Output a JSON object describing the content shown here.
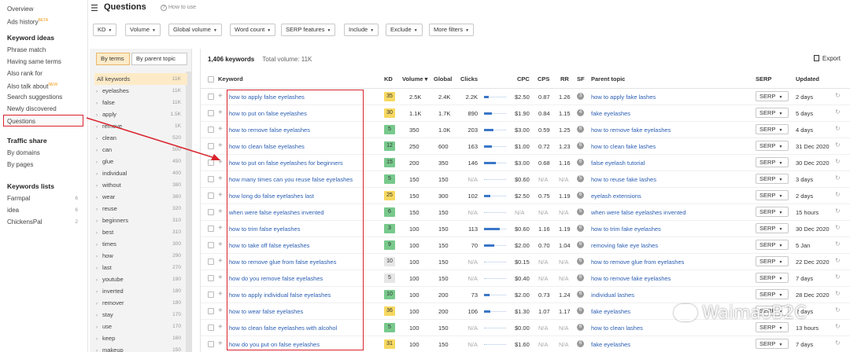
{
  "leftnav": {
    "items_top": [
      {
        "label": "Overview",
        "badge": ""
      },
      {
        "label": "Ads history",
        "badge": "BETA"
      }
    ],
    "keyword_ideas_title": "Keyword ideas",
    "keyword_ideas": [
      {
        "label": "Phrase match",
        "badge": ""
      },
      {
        "label": "Having same terms",
        "badge": ""
      },
      {
        "label": "Also rank for",
        "badge": ""
      },
      {
        "label": "Also talk about",
        "badge": "NEW"
      },
      {
        "label": "Search suggestions",
        "badge": ""
      },
      {
        "label": "Newly discovered",
        "badge": ""
      },
      {
        "label": "Questions",
        "badge": ""
      }
    ],
    "traffic_share_title": "Traffic share",
    "traffic_share": [
      {
        "label": "By domains"
      },
      {
        "label": "By pages"
      }
    ],
    "keywords_lists_title": "Keywords lists",
    "keywords_lists": [
      {
        "label": "Farmpal",
        "count": "6"
      },
      {
        "label": "idea",
        "count": "6"
      },
      {
        "label": "ChickensPal",
        "count": "2"
      }
    ]
  },
  "header": {
    "title": "Questions",
    "help": "How to use"
  },
  "filters": [
    "KD",
    "Volume",
    "Global volume",
    "Word count",
    "SERP features",
    "Include",
    "Exclude",
    "More filters"
  ],
  "terms": {
    "tabs": [
      "By terms",
      "By parent topic"
    ],
    "items": [
      {
        "term": "All keywords",
        "count": "11K"
      },
      {
        "term": "eyelashes",
        "count": "11K"
      },
      {
        "term": "false",
        "count": "11K"
      },
      {
        "term": "apply",
        "count": "1.5K"
      },
      {
        "term": "remove",
        "count": "1K"
      },
      {
        "term": "clean",
        "count": "520"
      },
      {
        "term": "can",
        "count": "500"
      },
      {
        "term": "glue",
        "count": "450"
      },
      {
        "term": "individual",
        "count": "400"
      },
      {
        "term": "without",
        "count": "380"
      },
      {
        "term": "wear",
        "count": "360"
      },
      {
        "term": "reuse",
        "count": "320"
      },
      {
        "term": "beginners",
        "count": "310"
      },
      {
        "term": "best",
        "count": "310"
      },
      {
        "term": "times",
        "count": "300"
      },
      {
        "term": "how",
        "count": "290"
      },
      {
        "term": "last",
        "count": "270"
      },
      {
        "term": "youtube",
        "count": "190"
      },
      {
        "term": "inverted",
        "count": "180"
      },
      {
        "term": "remover",
        "count": "180"
      },
      {
        "term": "stay",
        "count": "170"
      },
      {
        "term": "use",
        "count": "170"
      },
      {
        "term": "keep",
        "count": "160"
      },
      {
        "term": "makeup",
        "count": "150"
      }
    ]
  },
  "summary": {
    "keywords": "1,406 keywords",
    "total_volume": "Total volume: 11K",
    "export": "Export"
  },
  "table": {
    "headers": {
      "keyword": "Keyword",
      "kd": "KD",
      "volume": "Volume",
      "volume_sort": "▾",
      "global": "Global",
      "clicks": "Clicks",
      "cpc": "CPC",
      "cps": "CPS",
      "rr": "RR",
      "sf": "SF",
      "parent": "Parent topic",
      "serp": "SERP",
      "updated": "Updated"
    },
    "serp_label": "SERP",
    "rows": [
      {
        "keyword": "how to apply false eyelashes",
        "kd": "35",
        "kd_color": "#f6d860",
        "volume": "2.5K",
        "global": "2.4K",
        "clicks": "2.2K",
        "clicks_bar": 0.22,
        "cpc": "$2.50",
        "cps": "0.87",
        "rr": "1.26",
        "sf": "3",
        "parent": "how to apply fake lashes",
        "updated": "2 days"
      },
      {
        "keyword": "how to put on false eyelashes",
        "kd": "30",
        "kd_color": "#f6d860",
        "volume": "1.1K",
        "global": "1.7K",
        "clicks": "890",
        "clicks_bar": 0.35,
        "cpc": "$1.90",
        "cps": "0.84",
        "rr": "1.15",
        "sf": "4",
        "parent": "fake eyelashes",
        "updated": "5 days"
      },
      {
        "keyword": "how to remove false eyelashes",
        "kd": "5",
        "kd_color": "#78c98c",
        "volume": "350",
        "global": "1.0K",
        "clicks": "203",
        "clicks_bar": 0.42,
        "cpc": "$3.00",
        "cps": "0.59",
        "rr": "1.25",
        "sf": "6",
        "parent": "how to remove fake eyelashes",
        "updated": "4 days"
      },
      {
        "keyword": "how to clean false eyelashes",
        "kd": "12",
        "kd_color": "#78c98c",
        "volume": "250",
        "global": "600",
        "clicks": "163",
        "clicks_bar": 0.35,
        "cpc": "$1.00",
        "cps": "0.72",
        "rr": "1.23",
        "sf": "6",
        "parent": "how to clean fake lashes",
        "updated": "31 Dec 2020"
      },
      {
        "keyword": "how to put on false eyelashes for beginners",
        "kd": "15",
        "kd_color": "#78c98c",
        "volume": "200",
        "global": "350",
        "clicks": "146",
        "clicks_bar": 0.55,
        "cpc": "$3.00",
        "cps": "0.68",
        "rr": "1.16",
        "sf": "6",
        "parent": "false eyelash tutorial",
        "updated": "30 Dec 2020"
      },
      {
        "keyword": "how many times can you reuse false eyelashes",
        "kd": "5",
        "kd_color": "#78c98c",
        "volume": "150",
        "global": "150",
        "clicks": "N/A",
        "clicks_bar": 0,
        "cpc": "$0.60",
        "cps": "N/A",
        "rr": "N/A",
        "sf": "5",
        "parent": "how to reuse fake lashes",
        "updated": "3 days"
      },
      {
        "keyword": "how long do false eyelashes last",
        "kd": "25",
        "kd_color": "#f6d860",
        "volume": "150",
        "global": "300",
        "clicks": "102",
        "clicks_bar": 0.3,
        "cpc": "$2.50",
        "cps": "0.75",
        "rr": "1.19",
        "sf": "6",
        "parent": "eyelash extensions",
        "updated": "2 days"
      },
      {
        "keyword": "when were false eyelashes invented",
        "kd": "6",
        "kd_color": "#78c98c",
        "volume": "150",
        "global": "150",
        "clicks": "N/A",
        "clicks_bar": 0,
        "cpc": "N/A",
        "cps": "N/A",
        "rr": "N/A",
        "sf": "5",
        "parent": "when were false eyelashes invented",
        "updated": "15 hours"
      },
      {
        "keyword": "how to trim false eyelashes",
        "kd": "3",
        "kd_color": "#78c98c",
        "volume": "100",
        "global": "150",
        "clicks": "113",
        "clicks_bar": 0.7,
        "cpc": "$0.60",
        "cps": "1.16",
        "rr": "1.19",
        "sf": "6",
        "parent": "how to trim fake eyelashes",
        "updated": "30 Dec 2020"
      },
      {
        "keyword": "how to take off false eyelashes",
        "kd": "9",
        "kd_color": "#78c98c",
        "volume": "100",
        "global": "150",
        "clicks": "70",
        "clicks_bar": 0.45,
        "cpc": "$2.00",
        "cps": "0.70",
        "rr": "1.04",
        "sf": "6",
        "parent": "removing fake eye lashes",
        "updated": "5 Jan"
      },
      {
        "keyword": "how to remove glue from false eyelashes",
        "kd": "10",
        "kd_color": "#e6e6e6",
        "volume": "100",
        "global": "150",
        "clicks": "N/A",
        "clicks_bar": 0,
        "cpc": "$0.15",
        "cps": "N/A",
        "rr": "N/A",
        "sf": "6",
        "parent": "how to remove glue from eyelashes",
        "updated": "22 Dec 2020"
      },
      {
        "keyword": "how do you remove false eyelashes",
        "kd": "5",
        "kd_color": "#e6e6e6",
        "volume": "100",
        "global": "150",
        "clicks": "N/A",
        "clicks_bar": 0,
        "cpc": "$0.40",
        "cps": "N/A",
        "rr": "N/A",
        "sf": "6",
        "parent": "how to remove fake eyelashes",
        "updated": "7 days"
      },
      {
        "keyword": "how to apply individual false eyelashes",
        "kd": "10",
        "kd_color": "#78c98c",
        "volume": "100",
        "global": "200",
        "clicks": "73",
        "clicks_bar": 0.25,
        "cpc": "$2.00",
        "cps": "0.73",
        "rr": "1.24",
        "sf": "6",
        "parent": "individual lashes",
        "updated": "28 Dec 2020"
      },
      {
        "keyword": "how to wear false eyelashes",
        "kd": "36",
        "kd_color": "#f6d860",
        "volume": "100",
        "global": "200",
        "clicks": "106",
        "clicks_bar": 0.3,
        "cpc": "$1.30",
        "cps": "1.07",
        "rr": "1.17",
        "sf": "6",
        "parent": "fake eyelashes",
        "updated": "2 days"
      },
      {
        "keyword": "how to clean false eyelashes with alcohol",
        "kd": "5",
        "kd_color": "#78c98c",
        "volume": "100",
        "global": "150",
        "clicks": "N/A",
        "clicks_bar": 0,
        "cpc": "$0.00",
        "cps": "N/A",
        "rr": "N/A",
        "sf": "6",
        "parent": "how to clean lashes",
        "updated": "13 hours"
      },
      {
        "keyword": "how do you put on false eyelashes",
        "kd": "31",
        "kd_color": "#f6d860",
        "volume": "100",
        "global": "150",
        "clicks": "N/A",
        "clicks_bar": 0,
        "cpc": "$1.60",
        "cps": "N/A",
        "rr": "N/A",
        "sf": "6",
        "parent": "fake eyelashes",
        "updated": "7 days"
      }
    ]
  },
  "watermark": "WaimaoB2C"
}
